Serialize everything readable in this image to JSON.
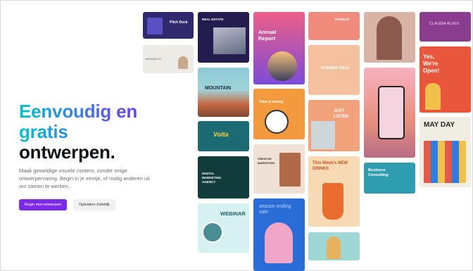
{
  "hero": {
    "headline_gradient": "Eenvoudig en gratis",
    "headline_dark": "ontwerpen.",
    "subtitle": "Maak geweldige visuele content, zonder enige ontwerpervaring. Begin in je eentje, of nodig anderen uit om samen te werken.",
    "primary_button": "Begin met ontwerpen",
    "secondary_button": "Opleiders Zakelijk"
  },
  "gallery": {
    "pitch_deck": "Pitch Deck",
    "minimalist": "MINIMALIST",
    "real_estate": "REAL ESTATE",
    "mountain": "MOUNTAIN",
    "volta": "Volta",
    "digital_marketing": "DIGITAL MARKETING AGENCY",
    "webinar": "WEBINAR",
    "annual_report": "Annual Report",
    "time_is_money": "Time is money",
    "creative_marketing": "CREATIVE MARKETING",
    "season_ending": "season ending sale",
    "fashion": "FASHION",
    "just_listed": "JUST LISTED",
    "new_drinks": "This Week's NEW DRINKS",
    "summer_sale": "SUMMER SALE",
    "business_consulting": "Business Consulting",
    "claudia_alves": "CLAUDIA ALVES",
    "yes_open": "Yes, We're Open!",
    "may_day": "MAY DAY"
  },
  "colors": {
    "accent": "#7d2ae8",
    "gradient_start": "#00c4cc",
    "gradient_end": "#7d2ae8",
    "headline_dark": "#0e1318"
  }
}
